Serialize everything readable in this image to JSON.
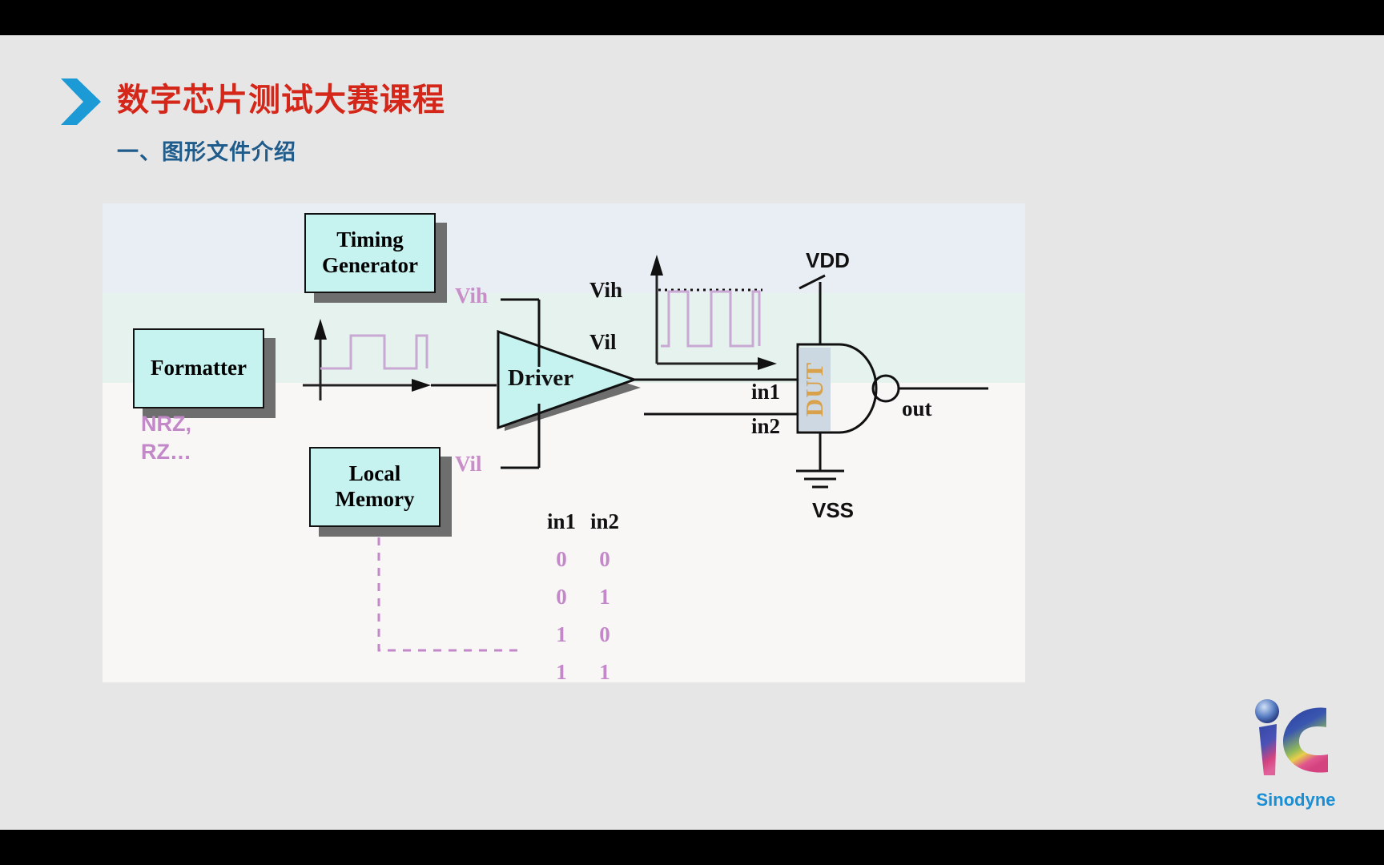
{
  "slide": {
    "title": "数字芯片测试大赛课程",
    "subtitle": "一、图形文件介绍",
    "title_color": "#d4271a",
    "subtitle_color": "#1f5c8b",
    "chevron_color": "#1b9ad6",
    "background": "#e6e6e6"
  },
  "diagram": {
    "boxes": [
      {
        "id": "timing-generator",
        "label": "Timing\nGenerator"
      },
      {
        "id": "formatter",
        "label": "Formatter"
      },
      {
        "id": "local-memory",
        "label": "Local\nMemory"
      }
    ],
    "box_fill": "#c6f2f0",
    "box_shadow": "#6e6e6e",
    "driver_label": "Driver",
    "driver_fill": "#c6f2f0",
    "formatter_note": "NRZ,\nRZ…",
    "formatter_note_color": "#c288c8",
    "driver_level_labels": {
      "high": "Vih",
      "low": "Vil",
      "color": "#c88ec8"
    },
    "output_level_labels": {
      "high": "Vih",
      "low": "Vil",
      "color": "#111111"
    },
    "dut": {
      "label": "DUT",
      "label_color": "#d9a24a",
      "gate_type": "NAND",
      "input1": "in1",
      "input2": "in2",
      "output": "out",
      "supply_top": "VDD",
      "supply_bottom": "VSS"
    },
    "waveform_color": "#c9a8d4",
    "threshold_line_style": "dotted"
  },
  "truth_table": {
    "headers": [
      "in1",
      "in2"
    ],
    "rows": [
      [
        "0",
        "0"
      ],
      [
        "0",
        "1"
      ],
      [
        "1",
        "0"
      ],
      [
        "1",
        "1"
      ]
    ],
    "value_color": "#c288c8",
    "header_color": "#111111"
  },
  "logo": {
    "name": "Sinodyne",
    "mark": "iC",
    "text_color": "#1b8fd4"
  }
}
